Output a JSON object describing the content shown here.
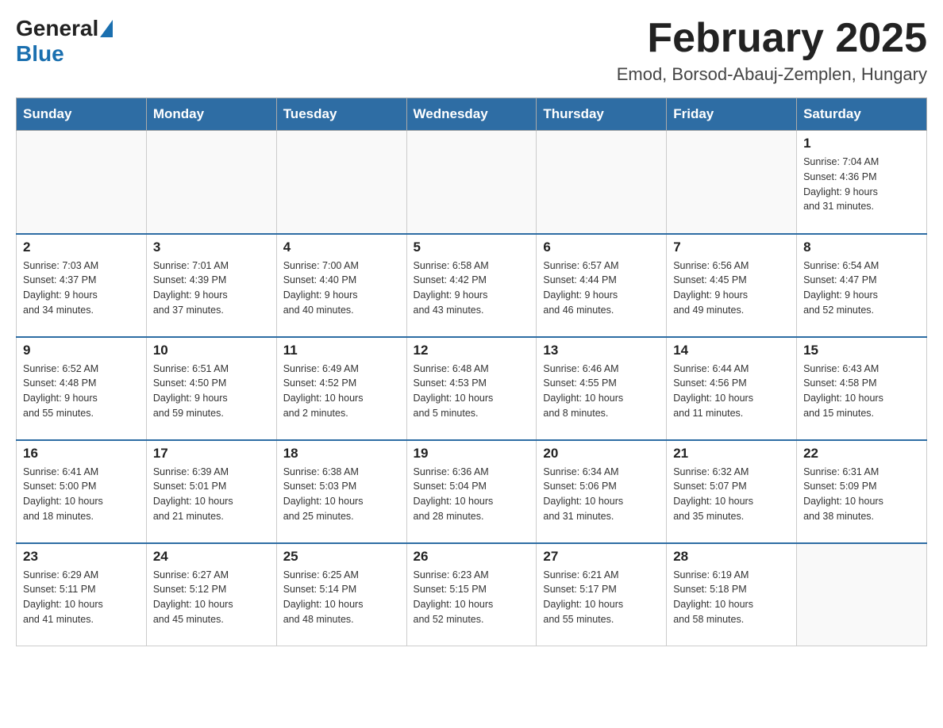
{
  "header": {
    "logo_general": "General",
    "logo_blue": "Blue",
    "month_title": "February 2025",
    "location": "Emod, Borsod-Abauj-Zemplen, Hungary"
  },
  "days_of_week": [
    "Sunday",
    "Monday",
    "Tuesday",
    "Wednesday",
    "Thursday",
    "Friday",
    "Saturday"
  ],
  "weeks": [
    {
      "days": [
        {
          "number": "",
          "info": ""
        },
        {
          "number": "",
          "info": ""
        },
        {
          "number": "",
          "info": ""
        },
        {
          "number": "",
          "info": ""
        },
        {
          "number": "",
          "info": ""
        },
        {
          "number": "",
          "info": ""
        },
        {
          "number": "1",
          "info": "Sunrise: 7:04 AM\nSunset: 4:36 PM\nDaylight: 9 hours\nand 31 minutes."
        }
      ]
    },
    {
      "days": [
        {
          "number": "2",
          "info": "Sunrise: 7:03 AM\nSunset: 4:37 PM\nDaylight: 9 hours\nand 34 minutes."
        },
        {
          "number": "3",
          "info": "Sunrise: 7:01 AM\nSunset: 4:39 PM\nDaylight: 9 hours\nand 37 minutes."
        },
        {
          "number": "4",
          "info": "Sunrise: 7:00 AM\nSunset: 4:40 PM\nDaylight: 9 hours\nand 40 minutes."
        },
        {
          "number": "5",
          "info": "Sunrise: 6:58 AM\nSunset: 4:42 PM\nDaylight: 9 hours\nand 43 minutes."
        },
        {
          "number": "6",
          "info": "Sunrise: 6:57 AM\nSunset: 4:44 PM\nDaylight: 9 hours\nand 46 minutes."
        },
        {
          "number": "7",
          "info": "Sunrise: 6:56 AM\nSunset: 4:45 PM\nDaylight: 9 hours\nand 49 minutes."
        },
        {
          "number": "8",
          "info": "Sunrise: 6:54 AM\nSunset: 4:47 PM\nDaylight: 9 hours\nand 52 minutes."
        }
      ]
    },
    {
      "days": [
        {
          "number": "9",
          "info": "Sunrise: 6:52 AM\nSunset: 4:48 PM\nDaylight: 9 hours\nand 55 minutes."
        },
        {
          "number": "10",
          "info": "Sunrise: 6:51 AM\nSunset: 4:50 PM\nDaylight: 9 hours\nand 59 minutes."
        },
        {
          "number": "11",
          "info": "Sunrise: 6:49 AM\nSunset: 4:52 PM\nDaylight: 10 hours\nand 2 minutes."
        },
        {
          "number": "12",
          "info": "Sunrise: 6:48 AM\nSunset: 4:53 PM\nDaylight: 10 hours\nand 5 minutes."
        },
        {
          "number": "13",
          "info": "Sunrise: 6:46 AM\nSunset: 4:55 PM\nDaylight: 10 hours\nand 8 minutes."
        },
        {
          "number": "14",
          "info": "Sunrise: 6:44 AM\nSunset: 4:56 PM\nDaylight: 10 hours\nand 11 minutes."
        },
        {
          "number": "15",
          "info": "Sunrise: 6:43 AM\nSunset: 4:58 PM\nDaylight: 10 hours\nand 15 minutes."
        }
      ]
    },
    {
      "days": [
        {
          "number": "16",
          "info": "Sunrise: 6:41 AM\nSunset: 5:00 PM\nDaylight: 10 hours\nand 18 minutes."
        },
        {
          "number": "17",
          "info": "Sunrise: 6:39 AM\nSunset: 5:01 PM\nDaylight: 10 hours\nand 21 minutes."
        },
        {
          "number": "18",
          "info": "Sunrise: 6:38 AM\nSunset: 5:03 PM\nDaylight: 10 hours\nand 25 minutes."
        },
        {
          "number": "19",
          "info": "Sunrise: 6:36 AM\nSunset: 5:04 PM\nDaylight: 10 hours\nand 28 minutes."
        },
        {
          "number": "20",
          "info": "Sunrise: 6:34 AM\nSunset: 5:06 PM\nDaylight: 10 hours\nand 31 minutes."
        },
        {
          "number": "21",
          "info": "Sunrise: 6:32 AM\nSunset: 5:07 PM\nDaylight: 10 hours\nand 35 minutes."
        },
        {
          "number": "22",
          "info": "Sunrise: 6:31 AM\nSunset: 5:09 PM\nDaylight: 10 hours\nand 38 minutes."
        }
      ]
    },
    {
      "days": [
        {
          "number": "23",
          "info": "Sunrise: 6:29 AM\nSunset: 5:11 PM\nDaylight: 10 hours\nand 41 minutes."
        },
        {
          "number": "24",
          "info": "Sunrise: 6:27 AM\nSunset: 5:12 PM\nDaylight: 10 hours\nand 45 minutes."
        },
        {
          "number": "25",
          "info": "Sunrise: 6:25 AM\nSunset: 5:14 PM\nDaylight: 10 hours\nand 48 minutes."
        },
        {
          "number": "26",
          "info": "Sunrise: 6:23 AM\nSunset: 5:15 PM\nDaylight: 10 hours\nand 52 minutes."
        },
        {
          "number": "27",
          "info": "Sunrise: 6:21 AM\nSunset: 5:17 PM\nDaylight: 10 hours\nand 55 minutes."
        },
        {
          "number": "28",
          "info": "Sunrise: 6:19 AM\nSunset: 5:18 PM\nDaylight: 10 hours\nand 58 minutes."
        },
        {
          "number": "",
          "info": ""
        }
      ]
    }
  ]
}
